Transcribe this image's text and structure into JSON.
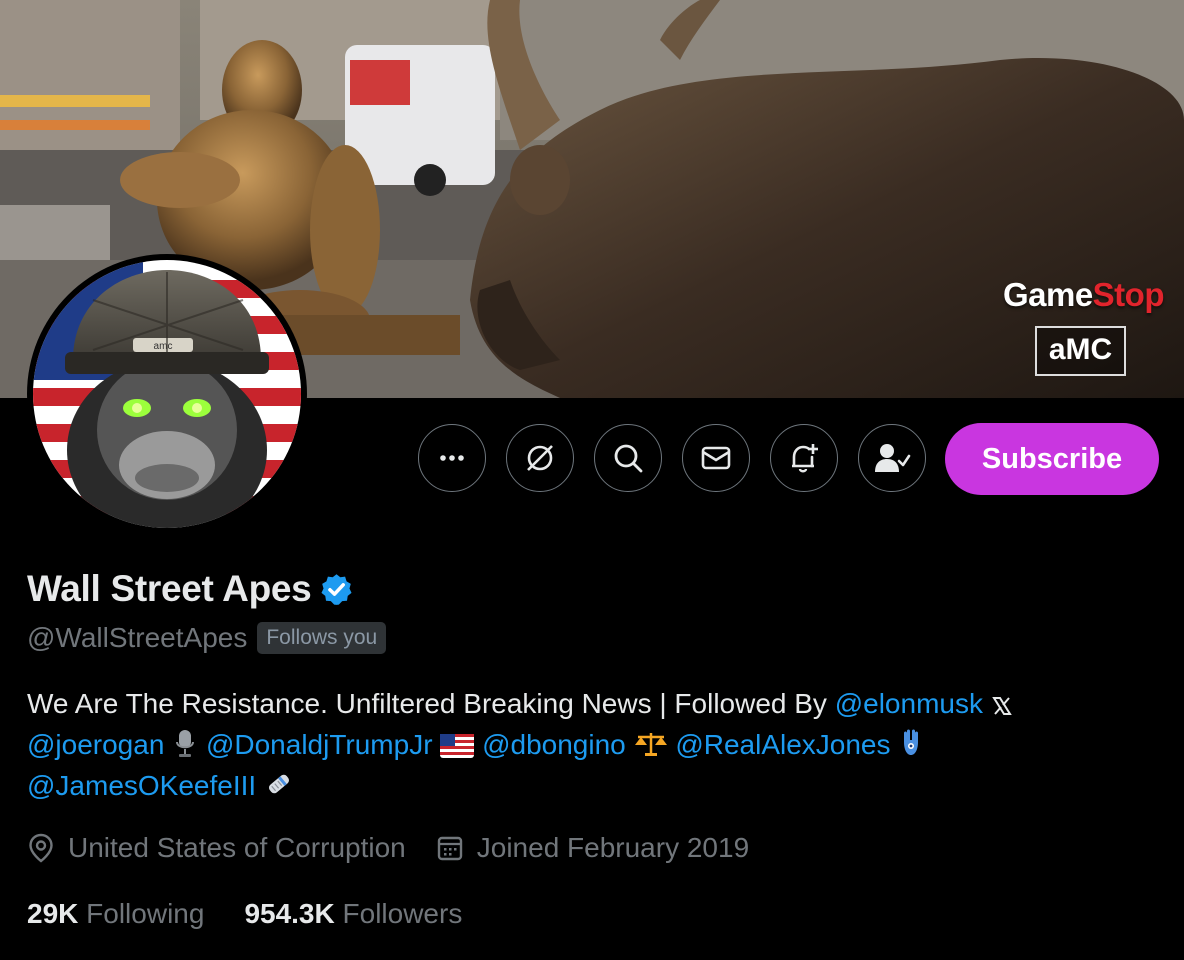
{
  "banner": {
    "brand_logo_1a": "Game",
    "brand_logo_1b": "Stop",
    "brand_logo_2": "aMC"
  },
  "actions": {
    "buttons": [
      {
        "name": "more-button",
        "icon": "ellipsis-icon"
      },
      {
        "name": "grok-button",
        "icon": "grok-icon"
      },
      {
        "name": "search-button",
        "icon": "search-icon"
      },
      {
        "name": "message-button",
        "icon": "envelope-icon"
      },
      {
        "name": "notify-button",
        "icon": "bell-plus-icon"
      },
      {
        "name": "following-button",
        "icon": "person-check-icon"
      }
    ],
    "subscribe_label": "Subscribe"
  },
  "profile": {
    "display_name": "Wall Street Apes",
    "verified": true,
    "handle": "@WallStreetApes",
    "follows_you_badge": "Follows you",
    "bio": {
      "text1": "We Are The Resistance. Unfiltered Breaking News | Followed By",
      "mention1": "@elonmusk",
      "mention2": "@joerogan",
      "mention3": "@DonaldjTrumpJr",
      "mention4": "@dbongino",
      "mention5": "@RealAlexJones",
      "mention6": "@JamesOKeefeIII"
    },
    "location": "United States of Corruption",
    "joined": "Joined February 2019",
    "following_count": "29K",
    "following_label": "Following",
    "followers_count": "954.3K",
    "followers_label": "Followers"
  },
  "colors": {
    "accent": "#1d9bf0",
    "subscribe": "#c936e0",
    "muted": "#71767b",
    "background": "#000000"
  }
}
